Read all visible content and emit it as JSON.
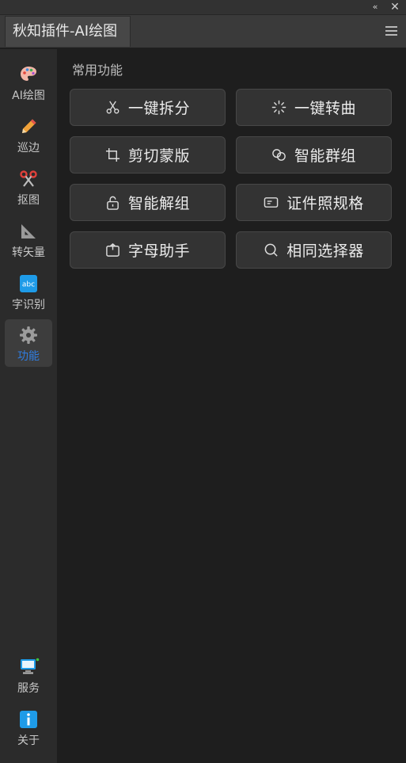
{
  "window": {
    "collapse_glyph": "‹‹",
    "close_glyph": "✕"
  },
  "tab": {
    "title": "秋知插件-AI绘图"
  },
  "sidebar": {
    "items": [
      {
        "label": "AI绘图",
        "icon": "palette-icon"
      },
      {
        "label": "巡边",
        "icon": "pencil-icon"
      },
      {
        "label": "抠图",
        "icon": "scissors-icon"
      },
      {
        "label": "转矢量",
        "icon": "triangle-ruler-icon"
      },
      {
        "label": "字识别",
        "icon": "abc-text-icon"
      },
      {
        "label": "功能",
        "icon": "gear-icon",
        "active": true
      },
      {
        "label": "服务",
        "icon": "monitor-icon"
      },
      {
        "label": "关于",
        "icon": "info-icon"
      }
    ]
  },
  "main": {
    "section_title": "常用功能",
    "buttons": [
      {
        "label": "一键拆分",
        "icon": "scissors-icon"
      },
      {
        "label": "一键转曲",
        "icon": "spinner-icon"
      },
      {
        "label": "剪切蒙版",
        "icon": "crop-icon"
      },
      {
        "label": "智能群组",
        "icon": "link-group-icon"
      },
      {
        "label": "智能解组",
        "icon": "unlock-icon"
      },
      {
        "label": "证件照规格",
        "icon": "id-card-icon"
      },
      {
        "label": "字母助手",
        "icon": "box-icon"
      },
      {
        "label": "相同选择器",
        "icon": "search-icon"
      }
    ]
  },
  "colors": {
    "active_nav": "#2f7de1",
    "status_online": "#3ec43e"
  }
}
